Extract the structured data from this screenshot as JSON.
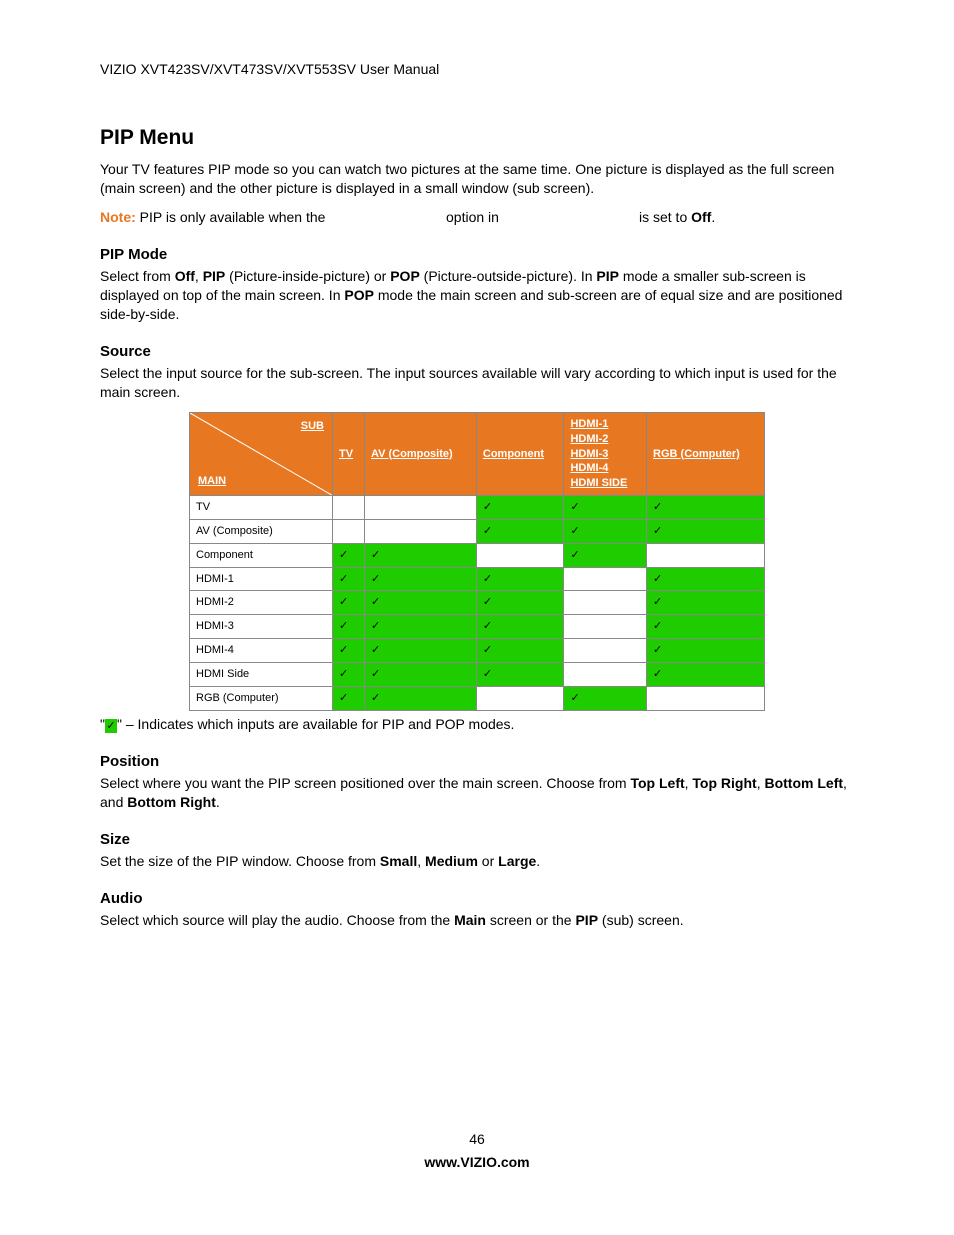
{
  "header": "VIZIO XVT423SV/XVT473SV/XVT553SV User Manual",
  "title": "PIP Menu",
  "intro": "Your TV features PIP mode so you can watch two pictures at the same time. One picture is displayed as the full screen (main screen) and the other picture is displayed in a small window (sub screen).",
  "note": {
    "label": "Note:",
    "t1": " PIP is only available when the ",
    "t2": "option in ",
    "t3": "is set to ",
    "off": "Off",
    "period": "."
  },
  "sections": {
    "pipmode": {
      "h": "PIP Mode",
      "p1a": "Select from ",
      "off": "Off",
      "sep1": ", ",
      "pip": "PIP",
      "pip_par": " (Picture-inside-picture) or ",
      "pop": "POP",
      "pop_par": " (Picture-outside-picture). In ",
      "pip2": "PIP",
      "mid": " mode a smaller sub-screen is displayed on top of the main screen. In ",
      "pop2": "POP",
      "end": " mode the main screen and sub-screen are of equal size and are positioned side-by-side."
    },
    "source": {
      "h": "Source",
      "p": "Select the input source for the sub-screen. The input sources available will vary according to which input is used for the main screen."
    },
    "position": {
      "h": "Position",
      "p1": "Select where you want the PIP screen positioned over the main screen. Choose from ",
      "tl": "Top Left",
      "s1": ", ",
      "tr": "Top Right",
      "s2": ", ",
      "bl": "Bottom Left",
      "s3": ", and ",
      "br": "Bottom Right",
      "s4": "."
    },
    "size": {
      "h": "Size",
      "p1": "Set the size of the PIP window. Choose from ",
      "sm": "Small",
      "s1": ", ",
      "md": "Medium",
      "s2": " or ",
      "lg": "Large",
      "s3": "."
    },
    "audio": {
      "h": "Audio",
      "p1": "Select which source will play the audio. Choose from the ",
      "main": "Main",
      "mid": " screen or the ",
      "pip": "PIP",
      "end": " (sub) screen."
    }
  },
  "table": {
    "corner": {
      "sub": "SUB",
      "main": "MAIN"
    },
    "cols": [
      "TV",
      "AV (Composite)",
      "Component",
      "HDMI",
      "RGB (Computer)"
    ],
    "hdmi_col_lines": [
      "HDMI-1",
      "HDMI-2",
      "HDMI-3",
      "HDMI-4",
      "HDMI SIDE"
    ],
    "rows": [
      {
        "label": "TV",
        "cells": [
          "",
          "",
          "✓",
          "✓",
          "✓"
        ]
      },
      {
        "label": "AV (Composite)",
        "cells": [
          "",
          "",
          "✓",
          "✓",
          "✓"
        ]
      },
      {
        "label": "Component",
        "cells": [
          "✓",
          "✓",
          "",
          "✓",
          ""
        ]
      },
      {
        "label": "HDMI-1",
        "cells": [
          "✓",
          "✓",
          "✓",
          "",
          "✓"
        ]
      },
      {
        "label": "HDMI-2",
        "cells": [
          "✓",
          "✓",
          "✓",
          "",
          "✓"
        ]
      },
      {
        "label": "HDMI-3",
        "cells": [
          "✓",
          "✓",
          "✓",
          "",
          "✓"
        ]
      },
      {
        "label": "HDMI-4",
        "cells": [
          "✓",
          "✓",
          "✓",
          "",
          "✓"
        ]
      },
      {
        "label": "HDMI Side",
        "cells": [
          "✓",
          "✓",
          "✓",
          "",
          "✓"
        ]
      },
      {
        "label": "RGB (Computer)",
        "cells": [
          "✓",
          "✓",
          "",
          "✓",
          ""
        ]
      }
    ]
  },
  "legend": {
    "q1": "\"",
    "check": "✓",
    "q2": "\" – Indicates which inputs are available for PIP and POP modes."
  },
  "footer": {
    "page": "46",
    "url": "www.VIZIO.com"
  }
}
